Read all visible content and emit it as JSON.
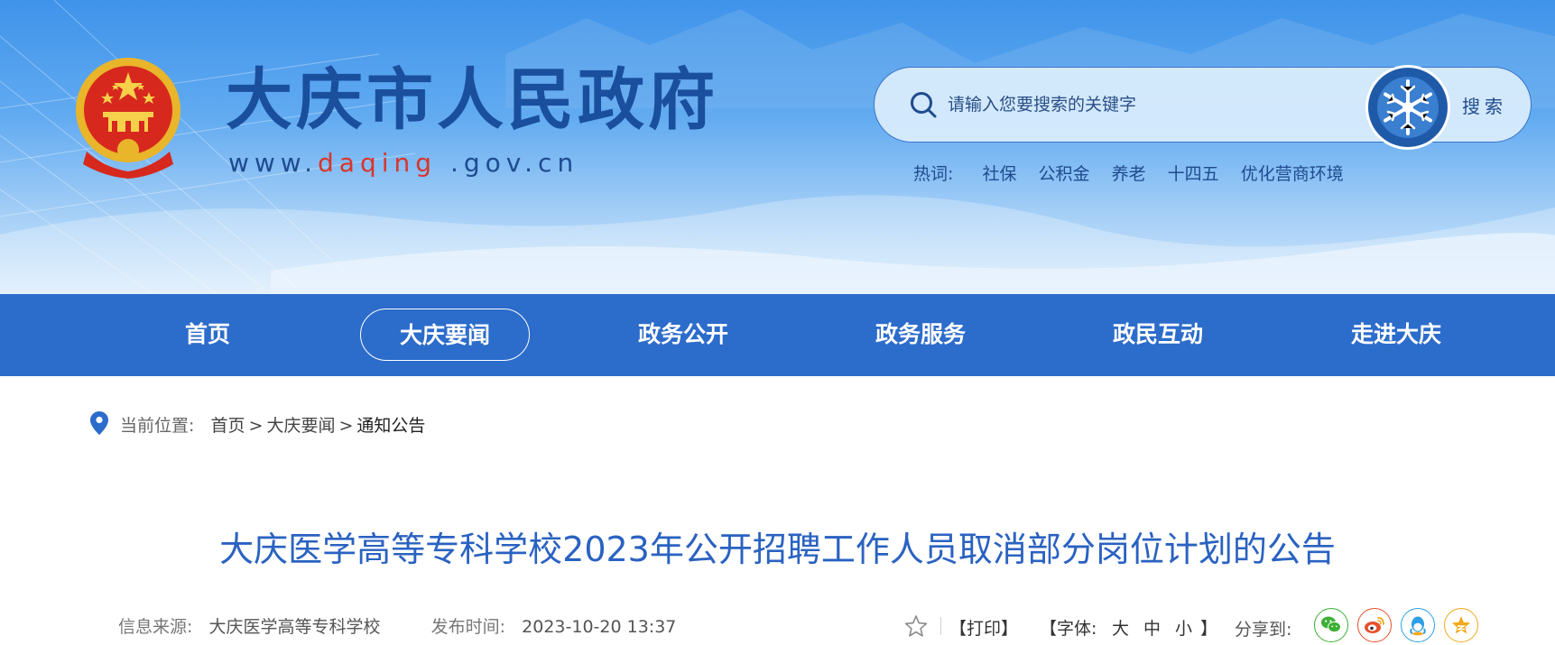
{
  "header": {
    "site_title": "大庆市人民政府",
    "url_prefix": "www.",
    "url_highlight": "daqing",
    "url_suffix": " .gov.cn"
  },
  "search": {
    "placeholder": "请输入您要搜索的关键字",
    "button_label": "搜索",
    "hot_label": "热词:",
    "hot_words": [
      "社保",
      "公积金",
      "养老",
      "十四五",
      "优化营商环境"
    ]
  },
  "nav": {
    "items": [
      {
        "label": "首页",
        "active": false
      },
      {
        "label": "大庆要闻",
        "active": true
      },
      {
        "label": "政务公开",
        "active": false
      },
      {
        "label": "政务服务",
        "active": false
      },
      {
        "label": "政民互动",
        "active": false
      },
      {
        "label": "走进大庆",
        "active": false
      }
    ]
  },
  "breadcrumb": {
    "label": "当前位置:",
    "items": [
      "首页",
      "大庆要闻",
      "通知公告"
    ],
    "separator": ">"
  },
  "article": {
    "title": "大庆医学高等专科学校2023年公开招聘工作人员取消部分岗位计划的公告",
    "source_label": "信息来源:",
    "source_value": "大庆医学高等专科学校",
    "time_label": "发布时间:",
    "time_value": "2023-10-20 13:37"
  },
  "tools": {
    "print_label": "【打印】",
    "font_label": "【字体:",
    "font_large": "大",
    "font_medium": "中",
    "font_small": "小",
    "font_close": "】",
    "share_label": "分享到:"
  },
  "colors": {
    "nav_bg": "#2c6ccb",
    "title_blue": "#2a62c1",
    "url_red": "#d9352b",
    "wechat": "#3cb034",
    "weibo": "#e6512b",
    "qq": "#2d9fe5",
    "qzone": "#f2a81b"
  }
}
